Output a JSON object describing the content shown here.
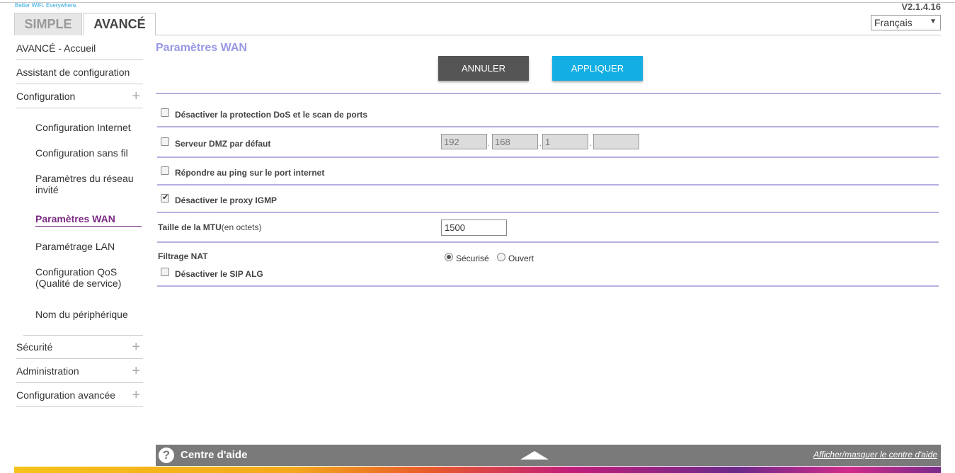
{
  "header": {
    "tagline": "Better WiFi. Everywhere.",
    "version": "V2.1.4.16",
    "language": "Français"
  },
  "tabs": {
    "simple": "SIMPLE",
    "advanced": "AVANCÉ"
  },
  "sidebar": {
    "home": "AVANCÉ - Accueil",
    "wizard": "Assistant de configuration",
    "configuration": "Configuration",
    "sub_items": [
      "Configuration Internet",
      "Configuration sans fil",
      "Paramètres du réseau invité",
      "Paramètres WAN",
      "Paramétrage LAN",
      "Configuration QoS (Qualité de service)",
      "Nom du périphérique"
    ],
    "security": "Sécurité",
    "administration": "Administration",
    "advanced_config": "Configuration avancée",
    "plus": "+"
  },
  "main": {
    "title": "Paramètres WAN",
    "cancel": "ANNULER",
    "apply": "APPLIQUER",
    "dos_label": "Désactiver la protection DoS et le scan de ports",
    "dmz_label": "Serveur DMZ par défaut",
    "dmz_ip": [
      "192",
      "168",
      "1",
      ""
    ],
    "ping_label": "Répondre au ping sur le port internet",
    "igmp_label": "Désactiver le proxy IGMP",
    "mtu_label_bold": "Taille de la MTU",
    "mtu_label_rest": "(en octets)",
    "mtu_value": "1500",
    "nat_label": "Filtrage NAT",
    "nat_secure": "Sécurisé",
    "nat_open": "Ouvert",
    "sip_label": "Désactiver le SIP ALG"
  },
  "help": {
    "title": "Centre d'aide",
    "toggle": "Afficher/masquer le centre d'aide",
    "icon": "?"
  }
}
